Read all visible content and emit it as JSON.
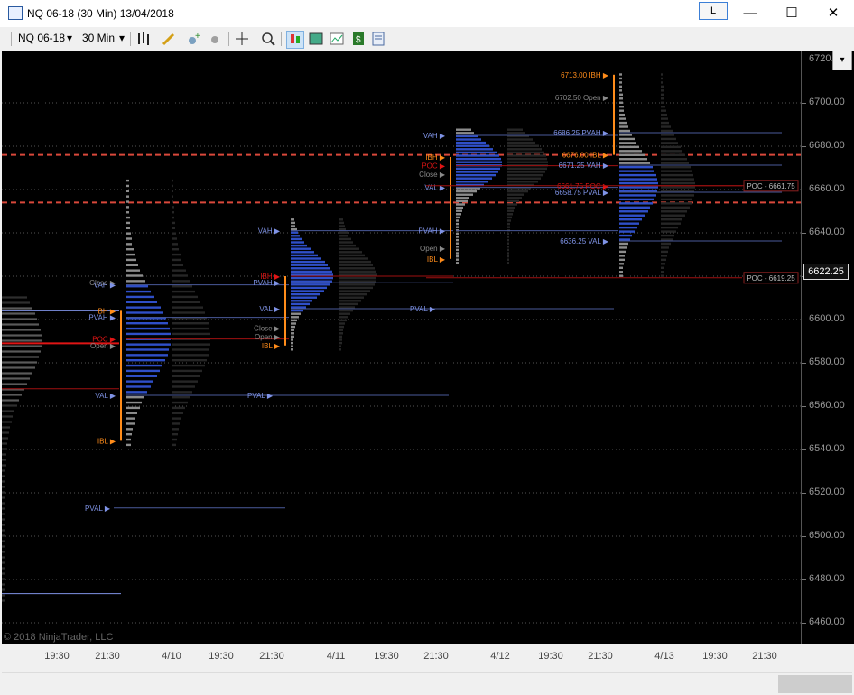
{
  "window": {
    "title": "NQ 06-18 (30 Min)  13/04/2018",
    "link_button": "L",
    "minimize_glyph": "—",
    "maximize_glyph": "☐",
    "close_glyph": "✕"
  },
  "toolbar": {
    "instrument": "NQ 06-18",
    "interval": "30 Min",
    "dropdown_glyph": "▾",
    "icons": [
      "bar-type-icon",
      "drawing-pencil-icon",
      "indicators-icon",
      "strategies-icon",
      "crosshair-icon",
      "zoom-icon",
      "chart-trader-icon",
      "data-box-icon",
      "chart-style-icon",
      "dollar-icon",
      "properties-icon"
    ]
  },
  "y_axis": {
    "ticks": [
      "6720.00",
      "6700.00",
      "6680.00",
      "6660.00",
      "6640.00",
      "6620.00",
      "6600.00",
      "6580.00",
      "6560.00",
      "6540.00",
      "6520.00",
      "6500.00",
      "6480.00",
      "6460.00"
    ],
    "tick_values": [
      6720,
      6700,
      6680,
      6660,
      6640,
      6620,
      6600,
      6580,
      6560,
      6540,
      6520,
      6500,
      6480,
      6460
    ],
    "current_price": "6622.25"
  },
  "x_axis": {
    "ticks": [
      "19:30",
      "21:30",
      "4/10",
      "19:30",
      "21:30",
      "4/11",
      "19:30",
      "21:30",
      "4/12",
      "19:30",
      "21:30",
      "4/13",
      "19:30",
      "21:30"
    ]
  },
  "copyright": "© 2018 NinjaTrader, LLC",
  "colors": {
    "background": "#000000",
    "profile_gray": "#8c8c8c",
    "value_area_blue": "#2f4fc8",
    "ib_orange": "#ff8c1a",
    "poc_red": "#e01515",
    "level_blue": "#7f93e6",
    "dashed_red": "#d9483b"
  },
  "chart_data": {
    "type": "market-profile",
    "price_range": [
      6456,
      6722
    ],
    "dashed_levels": [
      6676,
      6654
    ],
    "dotted_levels": [
      6700,
      6680,
      6660,
      6640,
      6620,
      6600,
      6580,
      6560,
      6540,
      6520,
      6500,
      6480,
      6460
    ],
    "profiles": [
      {
        "name": "profile-4-9",
        "low": 6542,
        "high": 6664,
        "value_area_low": 6565,
        "value_area_high": 6616,
        "poc": 6591,
        "width_max": 46,
        "labels": [
          {
            "text": "Close",
            "price": 6617,
            "kind": "gray"
          },
          {
            "text": "VAH",
            "price": 6616,
            "kind": "blue"
          },
          {
            "text": "IBH",
            "price": 6604,
            "kind": "orange"
          },
          {
            "text": "PVAH",
            "price": 6601,
            "kind": "blue"
          },
          {
            "text": "POC",
            "price": 6591,
            "kind": "red"
          },
          {
            "text": "Open",
            "price": 6588,
            "kind": "gray"
          },
          {
            "text": "VAL",
            "price": 6565,
            "kind": "blue"
          },
          {
            "text": "IBL",
            "price": 6544,
            "kind": "orange"
          }
        ],
        "ib_low": 6544,
        "ib_high": 6604
      },
      {
        "name": "profile-4-10",
        "low": 6586,
        "high": 6647,
        "value_area_low": 6604,
        "value_area_high": 6640,
        "poc": 6620,
        "width_max": 44,
        "labels": [
          {
            "text": "VAH",
            "price": 6641,
            "kind": "blue"
          },
          {
            "text": "IBH",
            "price": 6620,
            "kind": "red"
          },
          {
            "text": "PVAH",
            "price": 6617,
            "kind": "blue"
          },
          {
            "text": "VAL",
            "price": 6605,
            "kind": "blue"
          },
          {
            "text": "Close",
            "price": 6596,
            "kind": "gray"
          },
          {
            "text": "Open",
            "price": 6592,
            "kind": "gray"
          },
          {
            "text": "IBL",
            "price": 6588,
            "kind": "orange"
          }
        ],
        "ib_low": 6588,
        "ib_high": 6620
      },
      {
        "name": "profile-4-11",
        "low": 6626,
        "high": 6688,
        "value_area_low": 6661,
        "value_area_high": 6685,
        "poc": 6672,
        "width_max": 48,
        "labels": [
          {
            "text": "VAH",
            "price": 6685,
            "kind": "blue"
          },
          {
            "text": "IBH",
            "price": 6675,
            "kind": "orange"
          },
          {
            "text": "POC",
            "price": 6671,
            "kind": "red"
          },
          {
            "text": "Close",
            "price": 6667,
            "kind": "gray"
          },
          {
            "text": "VAL",
            "price": 6661,
            "kind": "blue"
          },
          {
            "text": "PVAH",
            "price": 6641,
            "kind": "blue"
          },
          {
            "text": "Open",
            "price": 6633,
            "kind": "gray"
          },
          {
            "text": "IBL",
            "price": 6628,
            "kind": "orange"
          }
        ],
        "ib_low": 6628,
        "ib_high": 6675
      },
      {
        "name": "profile-4-12",
        "low": 6620,
        "high": 6713,
        "value_area_low": 6636,
        "value_area_high": 6671,
        "poc": 6661.75,
        "width_max": 40,
        "labels": [
          {
            "text": "6713.00 IBH",
            "price": 6713,
            "kind": "orange"
          },
          {
            "text": "6702.50 Open",
            "price": 6702.5,
            "kind": "gray"
          },
          {
            "text": "6686.25 PVAH",
            "price": 6686.25,
            "kind": "blue"
          },
          {
            "text": "6676.00 IBL",
            "price": 6676,
            "kind": "orange"
          },
          {
            "text": "6671.25 VAH",
            "price": 6671.25,
            "kind": "blue"
          },
          {
            "text": "6661.75 POC",
            "price": 6661.75,
            "kind": "red"
          },
          {
            "text": "6658.75 PVAL",
            "price": 6658.75,
            "kind": "blue"
          },
          {
            "text": "6636.25 VAL",
            "price": 6636.25,
            "kind": "blue"
          }
        ],
        "ib_low": 6676,
        "ib_high": 6713
      }
    ],
    "standalone_levels": [
      {
        "text": "PVAL",
        "price": 6565
      },
      {
        "text": "PVAL",
        "price": 6605
      },
      {
        "text": "PVAL",
        "price": 6513
      }
    ],
    "poc_tags": [
      {
        "text": "POC - 6661.75",
        "price": 6661.75
      },
      {
        "text": "POC - 6619.25",
        "price": 6619.25
      }
    ]
  }
}
